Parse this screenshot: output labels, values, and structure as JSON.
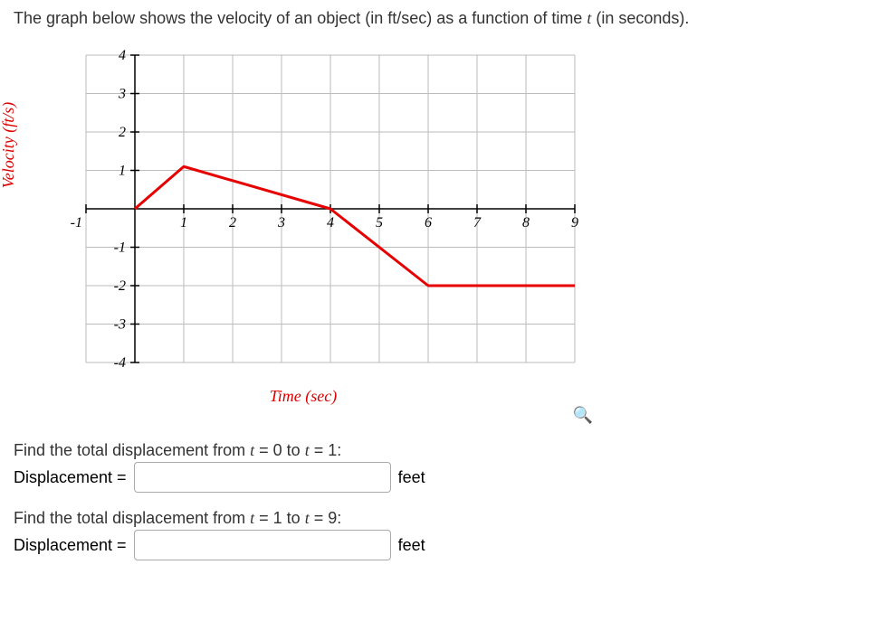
{
  "intro_prefix": "The graph below shows the velocity of an object (in ft/sec) as a function of time ",
  "intro_var": "t",
  "intro_suffix": " (in seconds).",
  "chart_data": {
    "type": "line",
    "title": "",
    "xlabel": "Time (sec)",
    "ylabel": "Velocity (ft/s)",
    "xlim": [
      -1,
      9
    ],
    "ylim": [
      -4,
      4
    ],
    "xticks": [
      -1,
      1,
      2,
      3,
      4,
      5,
      6,
      7,
      8,
      9
    ],
    "yticks": [
      -4,
      -3,
      -2,
      -1,
      1,
      2,
      3,
      4
    ],
    "series": [
      {
        "name": "velocity",
        "color": "#e60000",
        "x": [
          0,
          1,
          4,
          6,
          9
        ],
        "y": [
          0,
          1.1,
          0,
          -2,
          -2
        ]
      }
    ]
  },
  "q1": {
    "prompt_parts": [
      "Find the total displacement from ",
      "t",
      " = 0 to ",
      "t",
      " = 1:"
    ],
    "label": "Displacement =",
    "units": "feet",
    "value": ""
  },
  "q2": {
    "prompt_parts": [
      "Find the total displacement from ",
      "t",
      " = 1 to ",
      "t",
      " = 9:"
    ],
    "label": "Displacement =",
    "units": "feet",
    "value": ""
  },
  "icons": {
    "magnify": "🔍"
  }
}
